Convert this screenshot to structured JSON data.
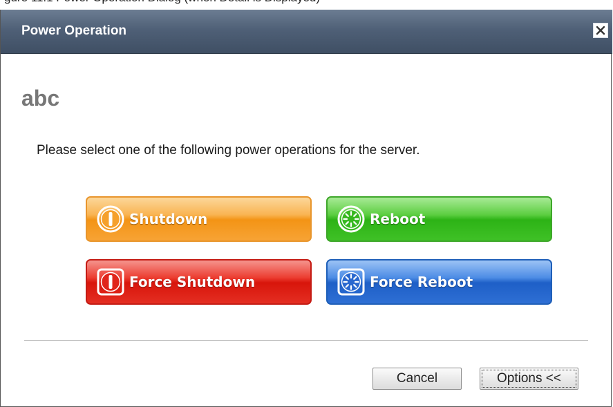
{
  "caption": "gure 11.1 Power Operation Dialog (when Detail is Displayed)",
  "dialog": {
    "title": "Power Operation",
    "close_icon": "close-icon",
    "heading": "abc",
    "instruction": "Please select one of the following power operations for the server.",
    "buttons": {
      "shutdown": {
        "label": "Shutdown",
        "icon": "power-icon",
        "color": "#f39415"
      },
      "reboot": {
        "label": "Reboot",
        "icon": "reboot-icon",
        "color": "#2db316"
      },
      "force_shutdown": {
        "label": "Force Shutdown",
        "icon": "power-icon",
        "color": "#d8150b"
      },
      "force_reboot": {
        "label": "Force Reboot",
        "icon": "reboot-icon",
        "color": "#1e5fc7"
      }
    },
    "footer": {
      "cancel_label": "Cancel",
      "options_label": "Options <<"
    }
  }
}
